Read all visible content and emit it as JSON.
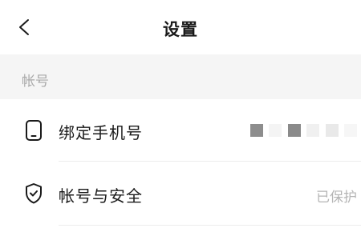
{
  "header": {
    "title": "设置",
    "back_icon": "chevron-left-icon"
  },
  "section": {
    "label": "帐号"
  },
  "rows": [
    {
      "label": "绑定手机号",
      "icon": "phone-icon",
      "value": ""
    },
    {
      "label": "帐号与安全",
      "icon": "shield-check-icon",
      "value": "已保护"
    }
  ],
  "colors": {
    "background": "#ffffff",
    "section_bg": "#f5f5f5",
    "primary_text": "#1a1a1a",
    "secondary_text": "#a9a9a9"
  }
}
